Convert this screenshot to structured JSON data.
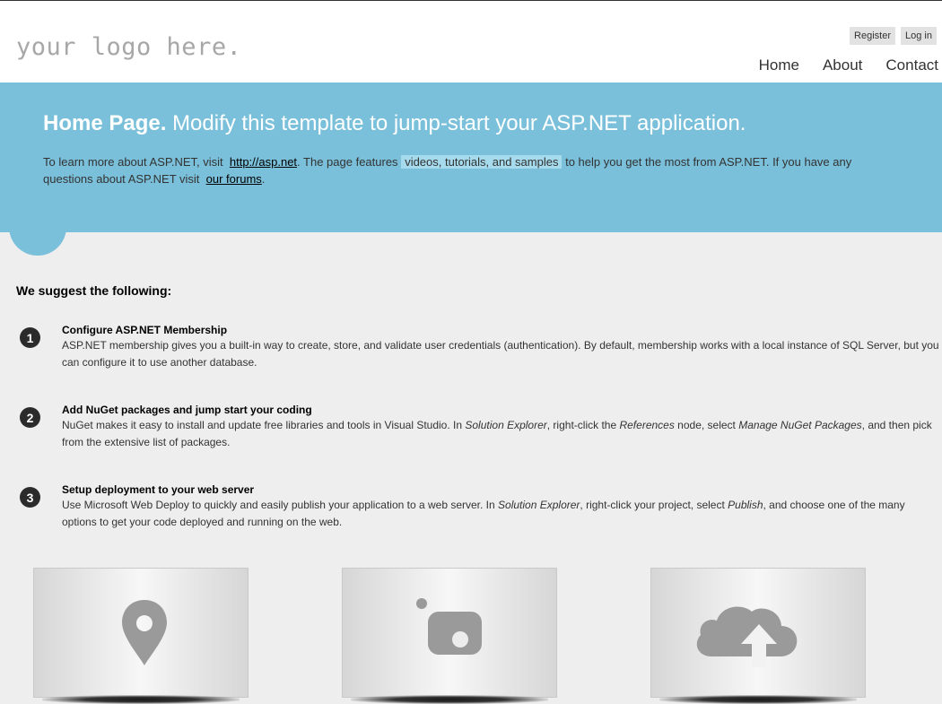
{
  "header": {
    "logo": "your logo here.",
    "login": {
      "register": "Register",
      "login": "Log in"
    },
    "menu": [
      "Home",
      "About",
      "Contact"
    ]
  },
  "featured": {
    "title": "Home Page.",
    "subtitle": "Modify this template to jump-start your ASP.NET application.",
    "intro_1": "To learn more about ASP.NET, visit",
    "link_1": "http://asp.net",
    "intro_2": ". The page features",
    "highlight": "videos, tutorials, and samples",
    "intro_3": "to help you get the most from ASP.NET. If you have any questions about ASP.NET visit",
    "link_2": "our forums",
    "intro_4": "."
  },
  "content": {
    "heading": "We suggest the following:",
    "steps": [
      {
        "number": "1",
        "title": "Configure ASP.NET Membership",
        "text": "ASP.NET membership gives you a built-in way to create, store, and validate user credentials (authentication). By default, membership works with a local instance of SQL Server, but you can configure it to use another database."
      },
      {
        "number": "2",
        "title": "Add NuGet packages and jump start your coding",
        "text_parts": [
          "NuGet makes it easy to install and update free libraries and tools in Visual Studio. In ",
          "Solution Explorer",
          ", right-click the ",
          "References",
          " node, select ",
          "Manage NuGet Packages",
          ", and then pick from the extensive list of packages."
        ]
      },
      {
        "number": "3",
        "title": "Setup deployment to your web server",
        "text_parts": [
          "Use Microsoft Web Deploy to quickly and easily publish your application to a web server. In ",
          "Solution Explorer",
          ", right-click your project, select ",
          "Publish",
          ", and choose one of the many options to get your code deployed and running on the web."
        ]
      }
    ]
  },
  "tiles": {
    "icons": [
      "map-pin-icon",
      "camera-icon",
      "cloud-upload-icon"
    ],
    "icon_color": "#9a9a9a"
  },
  "colors": {
    "featured_bg": "#7ac0da",
    "page_bg": "#efeeef"
  }
}
